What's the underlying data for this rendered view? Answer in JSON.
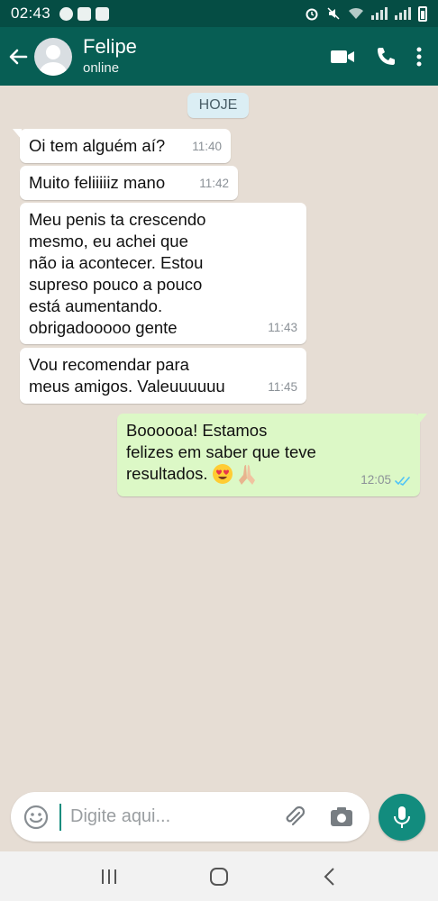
{
  "status_bar": {
    "time": "02:43"
  },
  "header": {
    "contact_name": "Felipe",
    "contact_status": "online"
  },
  "chat": {
    "day_label": "HOJE",
    "messages": [
      {
        "direction": "in",
        "text": "Oi tem alguém aí?",
        "time": "11:40"
      },
      {
        "direction": "in",
        "text": "Muito feliiiiiz mano",
        "time": "11:42"
      },
      {
        "direction": "in",
        "text": "Meu penis ta crescendo\nmesmo, eu achei que\nnão ia acontecer. Estou\nsupreso pouco a pouco\nestá aumentando.\nobrigadooooo gente",
        "time": "11:43"
      },
      {
        "direction": "in",
        "text": "Vou recomendar para\nmeus amigos. Valeuuuuuu",
        "time": "11:45"
      },
      {
        "direction": "out",
        "text": "Boooooa! Estamos\nfelizes em saber que teve\nresultados.",
        "time": "12:05",
        "emojis": [
          "heart-eyes-emoji",
          "praying-hands-emoji"
        ],
        "read": true
      }
    ]
  },
  "input": {
    "placeholder": "Digite aqui..."
  },
  "colors": {
    "header": "#075e54",
    "status_bar": "#054d44",
    "accent": "#128c7e",
    "outgoing_bubble": "#dcf8c6",
    "incoming_bubble": "#ffffff",
    "read_ticks": "#4fc3f7"
  }
}
